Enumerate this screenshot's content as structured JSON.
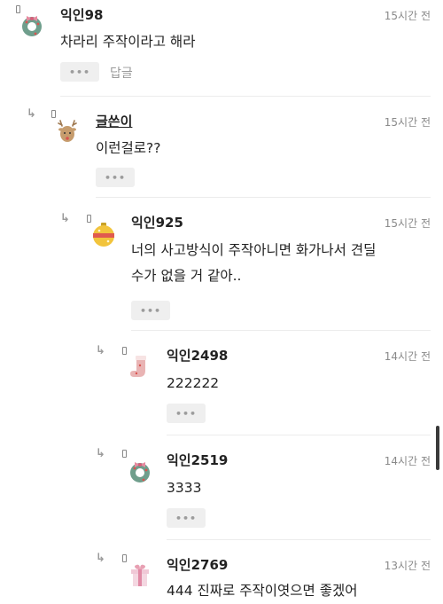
{
  "ui": {
    "more_glyph": "•••",
    "reply_arrow": "↳"
  },
  "comments": [
    {
      "id": "c1",
      "name": "익인98",
      "time": "15시간 전",
      "text": [
        "차라리 주작이라고 해라"
      ],
      "reply_label": "답글",
      "avatar_icon": "wreath-icon"
    },
    {
      "id": "c2",
      "name": "글쓴이",
      "time": "15시간 전",
      "text": [
        "이런걸로??"
      ],
      "avatar_icon": "reindeer-icon"
    },
    {
      "id": "c3",
      "name": "익인925",
      "time": "15시간 전",
      "text": [
        "너의 사고방식이 주작아니면 화가나서 견딜",
        "수가 없을 거 같아.."
      ],
      "avatar_icon": "ornament-icon"
    },
    {
      "id": "c4",
      "name": "익인2498",
      "time": "14시간 전",
      "text": [
        "222222"
      ],
      "avatar_icon": "stocking-icon"
    },
    {
      "id": "c5",
      "name": "익인2519",
      "time": "14시간 전",
      "text": [
        "3333"
      ],
      "avatar_icon": "wreath-icon"
    },
    {
      "id": "c6",
      "name": "익인2769",
      "time": "13시간 전",
      "text": [
        "444 진짜로 주작이엿으면 좋겠어"
      ],
      "avatar_icon": "gift-box-icon"
    }
  ]
}
